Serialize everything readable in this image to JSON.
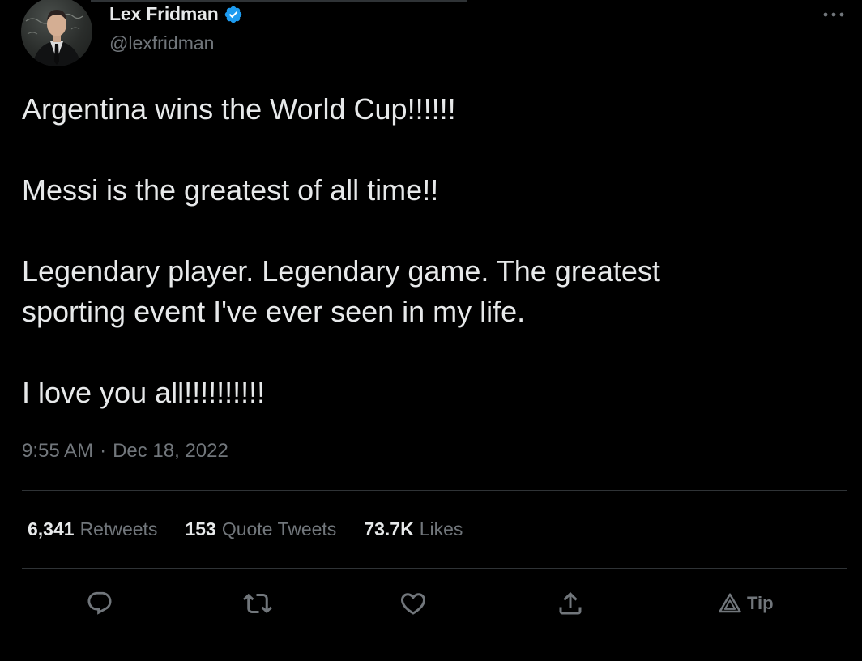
{
  "author": {
    "name": "Lex Fridman",
    "handle": "@lexfridman"
  },
  "tweet": {
    "lines": [
      "Argentina wins the World Cup!!!!!!",
      "Messi is the greatest of all time!!",
      "Legendary player. Legendary game. The greatest sporting event I've ever seen in my life.",
      "I love you all!!!!!!!!!!"
    ],
    "time": "9:55 AM",
    "separator": "·",
    "date": "Dec 18, 2022"
  },
  "stats": {
    "retweets_count": "6,341",
    "retweets_label": "Retweets",
    "quotes_count": "153",
    "quotes_label": "Quote Tweets",
    "likes_count": "73.7K",
    "likes_label": "Likes"
  },
  "actions": {
    "reply_icon": "reply-icon",
    "retweet_icon": "retweet-icon",
    "like_icon": "heart-icon",
    "share_icon": "share-icon",
    "tip_icon": "tip-icon",
    "tip_label": "Tip"
  },
  "colors": {
    "background": "#000000",
    "text_primary": "#e7e9ea",
    "text_secondary": "#71767b",
    "verified_blue": "#1d9bf0",
    "divider": "#2f3336"
  }
}
